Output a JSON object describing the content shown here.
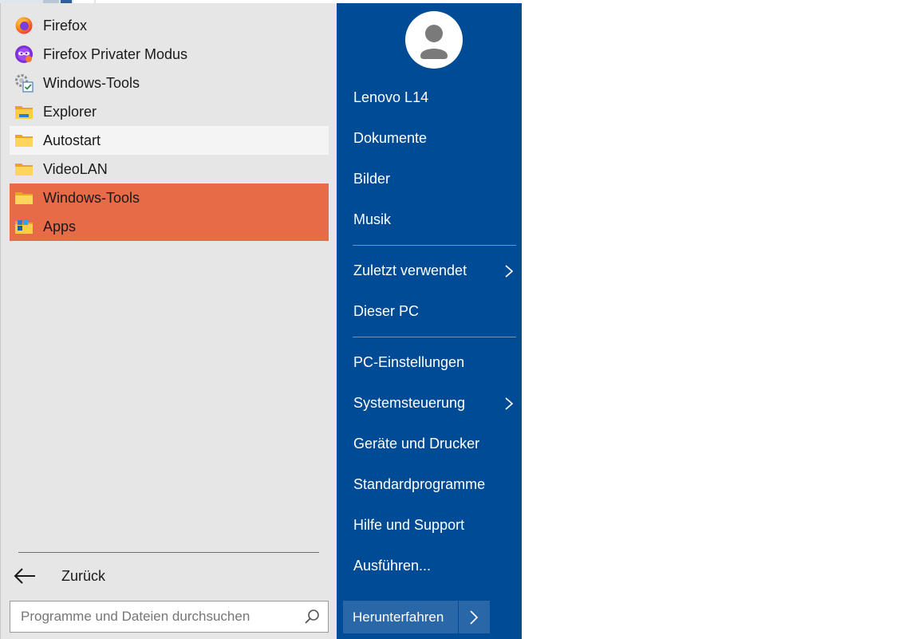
{
  "programs": [
    {
      "label": "Firefox",
      "icon": "firefox-icon"
    },
    {
      "label": "Firefox Privater Modus",
      "icon": "firefox-private-icon"
    },
    {
      "label": "Windows-Tools",
      "icon": "windows-tools-icon"
    },
    {
      "label": "Explorer",
      "icon": "explorer-icon"
    },
    {
      "label": "Autostart",
      "icon": "folder-icon"
    },
    {
      "label": "VideoLAN",
      "icon": "folder-icon"
    },
    {
      "label": "Windows-Tools",
      "icon": "folder-icon"
    },
    {
      "label": "Apps",
      "icon": "apps-icon"
    }
  ],
  "back": {
    "label": "Zurück",
    "icon": "arrow-left-icon"
  },
  "search": {
    "placeholder": "Programme und Dateien durchsuchen",
    "value": "",
    "icon": "search-icon"
  },
  "user": {
    "icon": "user-avatar-icon"
  },
  "right_items": [
    {
      "label": "Lenovo L14"
    },
    {
      "label": "Dokumente"
    },
    {
      "label": "Bilder"
    },
    {
      "label": "Musik"
    },
    {
      "label": "Zuletzt verwendet",
      "has_submenu": true
    },
    {
      "label": "Dieser PC"
    },
    {
      "label": "PC-Einstellungen"
    },
    {
      "label": "Systemsteuerung",
      "has_submenu": true
    },
    {
      "label": "Geräte und Drucker"
    },
    {
      "label": "Standardprogramme"
    },
    {
      "label": "Hilfe und Support"
    },
    {
      "label": "Ausführen..."
    }
  ],
  "shutdown": {
    "label": "Herunterfahren",
    "arrow_icon": "chevron-right-icon"
  },
  "colors": {
    "left_bg": "#e6e6e6",
    "right_bg": "#004b96",
    "selection": "#e66b46",
    "hover": "#f4f4f4",
    "button_bg": "#2a67a8"
  }
}
